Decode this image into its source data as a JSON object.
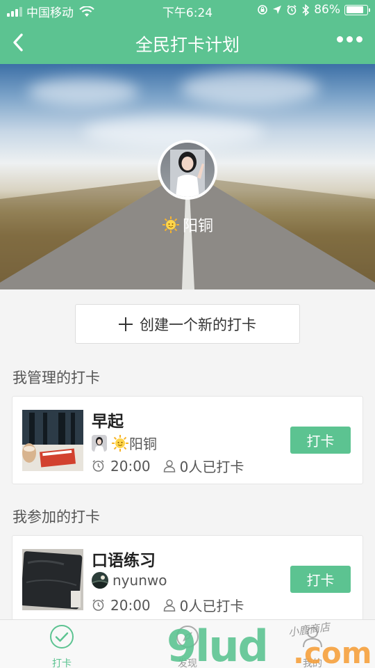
{
  "status_bar": {
    "carrier": "中国移动",
    "time": "下午6:24",
    "battery": "86%",
    "battery_level": 0.86
  },
  "nav": {
    "title": "全民打卡计划",
    "back_icon": "chevron-left-icon",
    "more_icon": "more-dots-icon"
  },
  "profile": {
    "username": "阳铜"
  },
  "create_button": {
    "label": "创建一个新的打卡"
  },
  "sections": {
    "managed_title": "我管理的打卡",
    "joined_title": "我参加的打卡"
  },
  "managed_cards": [
    {
      "name": "早起",
      "owner": "阳铜",
      "time": "20:00",
      "count": "0人已打卡",
      "button": "打卡"
    }
  ],
  "joined_cards": [
    {
      "name": "口语练习",
      "owner": "nyunwo",
      "time": "20:00",
      "count": "0人已打卡",
      "button": "打卡"
    }
  ],
  "tabbar": {
    "tabs": [
      {
        "label": "打卡",
        "icon": "check-circle-icon",
        "active": true
      },
      {
        "label": "发现",
        "icon": "discover-icon",
        "active": false
      },
      {
        "label": "我的",
        "icon": "user-icon",
        "active": false
      }
    ]
  },
  "watermark": {
    "logo": "9lud",
    "suffix": ".com",
    "shop": "小鹿商店"
  },
  "colors": {
    "accent": "#5cc391",
    "background": "#f4f4f4"
  }
}
